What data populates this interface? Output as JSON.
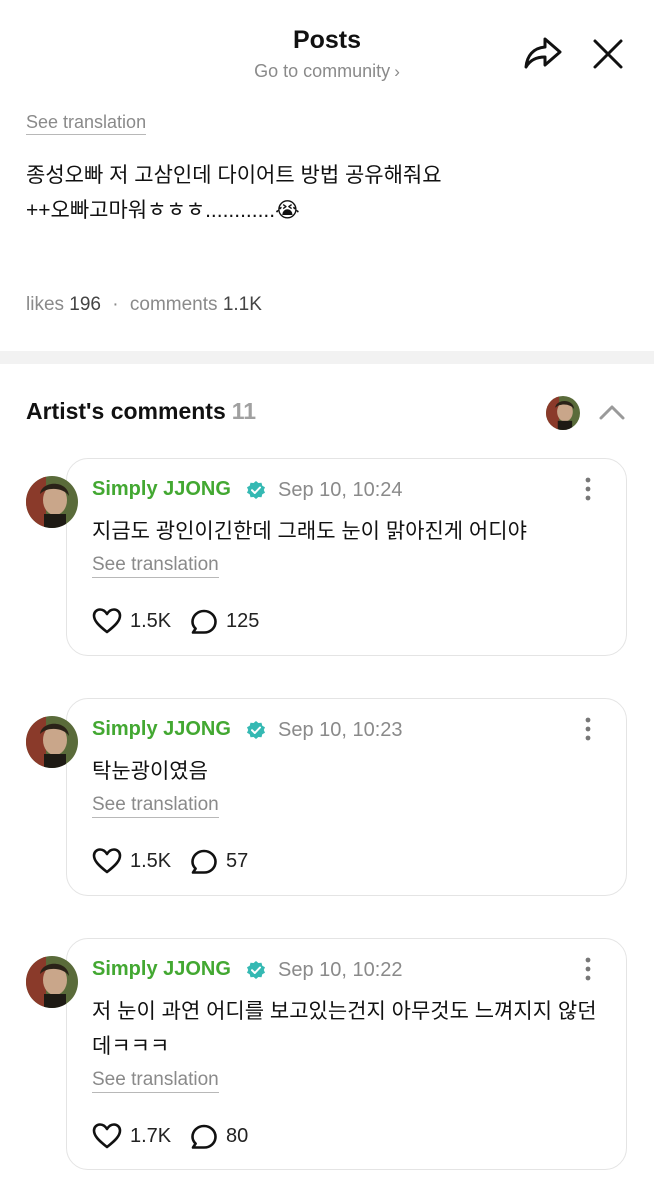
{
  "header": {
    "title": "Posts",
    "subtitle": "Go to community",
    "subtitle_chevron": "›",
    "icons": {
      "share": "share-arrow-icon",
      "close": "close-icon"
    }
  },
  "post": {
    "see_translation": "See translation",
    "body_line1": "종성오빠 저 고삼인데 다이어트 방법 공유해줘요",
    "body_line2": "++오빠고마워ㅎㅎㅎ............😭",
    "likes_label": "likes",
    "likes_count": "196",
    "separator": "·",
    "comments_label": "comments",
    "comments_count": "1.1K"
  },
  "artist_comments": {
    "title": "Artist's comments",
    "count": "11",
    "icons": {
      "collapse": "chevron-up-icon"
    },
    "comments": [
      {
        "author": "Simply JJONG",
        "time": "Sep 10, 10:24",
        "text": "지금도 광인이긴한데 그래도 눈이 맑아진게 어디야",
        "see_translation": "See translation",
        "likes": "1.5K",
        "replies": "125"
      },
      {
        "author": "Simply JJONG",
        "time": "Sep 10, 10:23",
        "text": "탁눈광이였음",
        "see_translation": "See translation",
        "likes": "1.5K",
        "replies": "57"
      },
      {
        "author": "Simply JJONG",
        "time": "Sep 10, 10:22",
        "text": "저 눈이 과연 어디를 보고있는건지 아무것도 느껴지지 않던데ㅋㅋㅋ",
        "see_translation": "See translation",
        "likes": "1.7K",
        "replies": "80"
      }
    ]
  },
  "colors": {
    "author_green": "#43a832",
    "verified_teal": "#35b9b3",
    "muted_gray": "#8a8a8a",
    "divider": "#f2f2f2"
  }
}
